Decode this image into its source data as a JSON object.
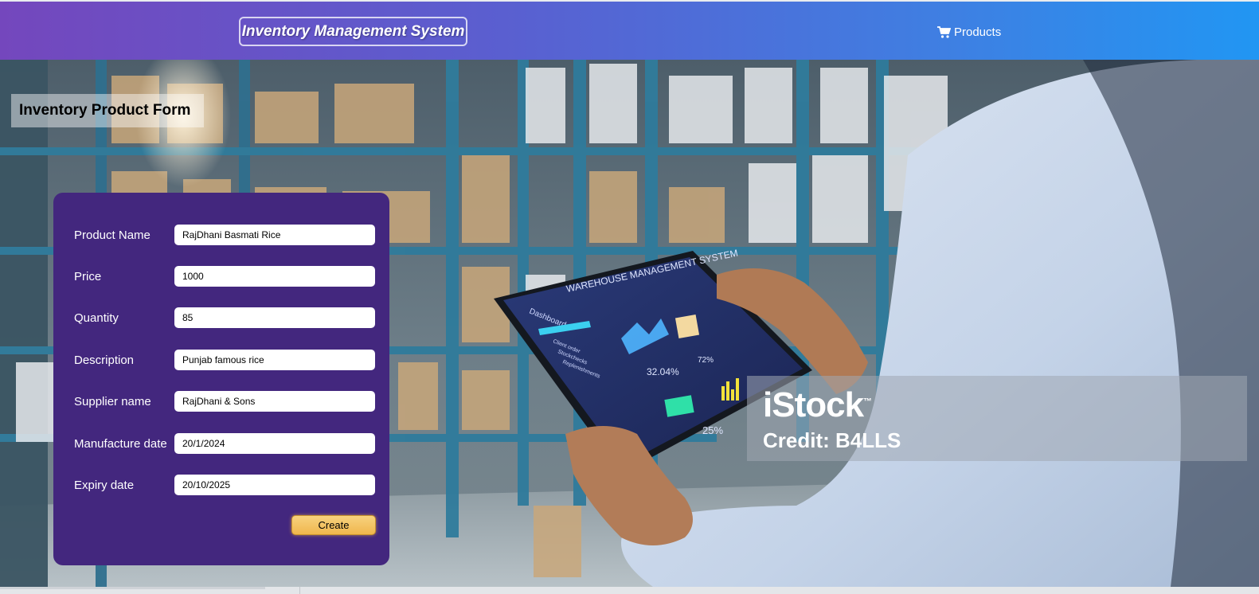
{
  "header": {
    "brand": "Inventory Management System",
    "nav": {
      "products_label": "Products"
    }
  },
  "page": {
    "title": "Inventory Product Form"
  },
  "form": {
    "fields": [
      {
        "label": "Product Name",
        "value": "RajDhani Basmati Rice"
      },
      {
        "label": "Price",
        "value": "1000"
      },
      {
        "label": "Quantity",
        "value": "85"
      },
      {
        "label": "Description",
        "value": "Punjab famous rice"
      },
      {
        "label": "Supplier name",
        "value": "RajDhani & Sons"
      },
      {
        "label": "Manufacture date",
        "value": "20/1/2024"
      },
      {
        "label": "Expiry date",
        "value": "20/10/2025"
      }
    ],
    "submit_label": "Create"
  },
  "watermark": {
    "logo": "iStock",
    "trademark": "™",
    "credit": "Credit: B4LLS"
  },
  "background_tablet": {
    "heading": "WAREHOUSE MANAGEMENT SYSTEM",
    "menu_title": "Dashboard",
    "menu_items": [
      "Client order",
      "Stockchecks",
      "Replenishments"
    ],
    "stats": [
      "32.04%",
      "72%",
      "25%"
    ]
  }
}
